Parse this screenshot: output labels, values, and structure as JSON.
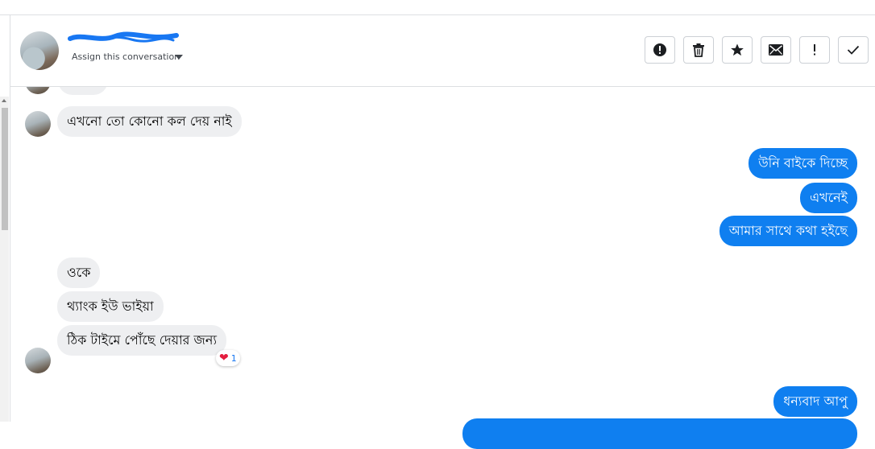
{
  "header": {
    "assign_label": "Assign this conversation",
    "toolbar": [
      {
        "name": "spam-button",
        "icon": "alert-circle-icon"
      },
      {
        "name": "delete-button",
        "icon": "trash-icon"
      },
      {
        "name": "star-button",
        "icon": "star-icon"
      },
      {
        "name": "mark-unread-button",
        "icon": "envelope-icon"
      },
      {
        "name": "important-button",
        "icon": "exclamation-icon"
      },
      {
        "name": "mark-done-button",
        "icon": "check-icon"
      }
    ]
  },
  "messages": [
    {
      "side": "incoming",
      "text": "এখনো তো কোনো কল দেয় নাই"
    },
    {
      "side": "outgoing",
      "text": "উনি বাইকে দিচ্ছে"
    },
    {
      "side": "outgoing",
      "text": "এখনেই"
    },
    {
      "side": "outgoing",
      "text": "আমার সাথে কথা হইছে"
    },
    {
      "side": "incoming",
      "text": "ওকে"
    },
    {
      "side": "incoming",
      "text": "থ্যাংক ইউ ভাইয়া"
    },
    {
      "side": "incoming",
      "text": "ঠিক টাইমে পোঁছে  দেয়ার জন্য"
    },
    {
      "side": "outgoing",
      "text": "ধন্যবাদ আপু"
    }
  ],
  "reaction": {
    "emoji": "❤",
    "count": "1"
  },
  "colors": {
    "outgoing_bubble": "#0f7ff0",
    "incoming_bubble": "#eeeff1",
    "name_scribble": "#1877f2"
  }
}
